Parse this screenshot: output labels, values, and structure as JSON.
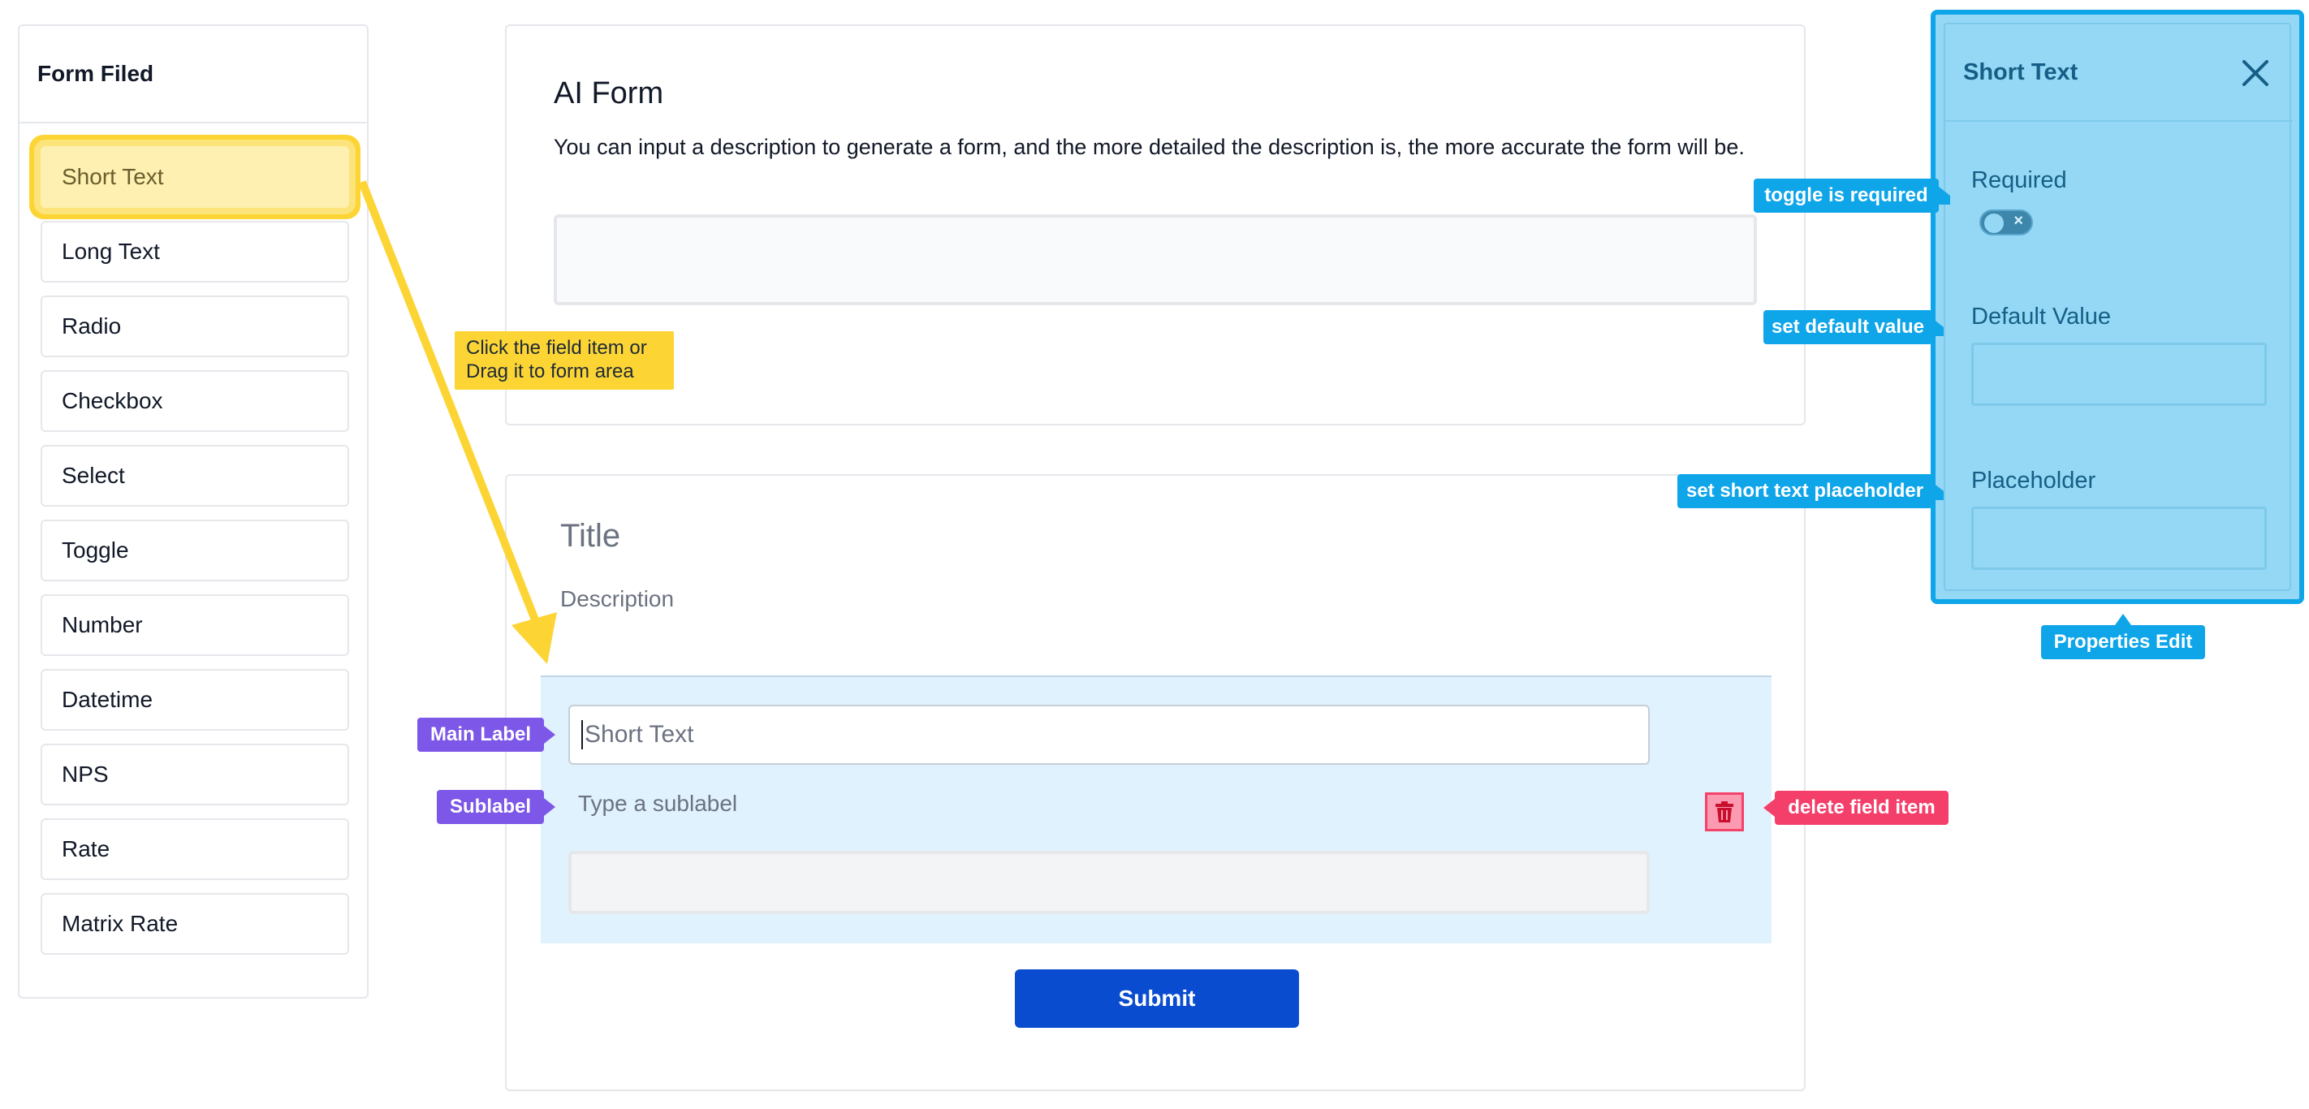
{
  "sidebar": {
    "title": "Form Filed",
    "items": [
      {
        "label": "Short Text"
      },
      {
        "label": "Long Text"
      },
      {
        "label": "Radio"
      },
      {
        "label": "Checkbox"
      },
      {
        "label": "Select"
      },
      {
        "label": "Toggle"
      },
      {
        "label": "Number"
      },
      {
        "label": "Datetime"
      },
      {
        "label": "NPS"
      },
      {
        "label": "Rate"
      },
      {
        "label": "Matrix Rate"
      }
    ]
  },
  "ai_form": {
    "title": "AI Form",
    "description": "You can input a description to generate a form, and the more detailed the description is, the more accurate the form will be.",
    "input_value": ""
  },
  "form": {
    "title": "Title",
    "description": "Description",
    "field": {
      "label": "Short Text",
      "sublabel_placeholder": "Type a sublabel"
    },
    "submit_label": "Submit"
  },
  "properties": {
    "title": "Short Text",
    "required_label": "Required",
    "toggle_off_glyph": "×",
    "default_value_label": "Default Value",
    "placeholder_label": "Placeholder"
  },
  "callouts": {
    "drag_note": "Click the field item or Drag it to form area",
    "toggle_required": "toggle is required",
    "set_default": "set default value",
    "set_placeholder": "set short text placeholder",
    "properties_edit": "Properties Edit",
    "main_label": "Main Label",
    "sublabel": "Sublabel",
    "delete_item": "delete field item"
  },
  "colors": {
    "primary": "#0a4ccf",
    "highlight": "#fcd535",
    "properties_bg": "#94d8f5",
    "callout_blue": "#0ea5e9",
    "callout_purple": "#7c57e8",
    "callout_red": "#f43f6b"
  }
}
